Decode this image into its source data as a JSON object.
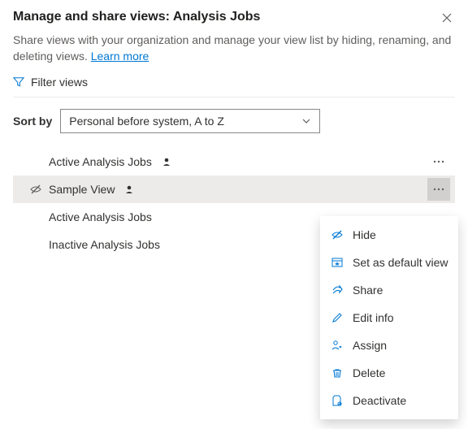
{
  "header": {
    "title": "Manage and share views: Analysis Jobs",
    "subtitle_pre": "Share views with your organization and manage your view list by hiding, renaming, and deleting views. ",
    "learn_more": "Learn more"
  },
  "filter": {
    "label": "Filter views"
  },
  "sort": {
    "label": "Sort by",
    "selected": "Personal before system, A to Z"
  },
  "views": [
    {
      "name": "Active Analysis Jobs",
      "personal": true,
      "hidden": false,
      "selected": false,
      "more": true
    },
    {
      "name": "Sample View",
      "personal": true,
      "hidden": true,
      "selected": true,
      "more": true
    },
    {
      "name": "Active Analysis Jobs",
      "personal": false,
      "hidden": false,
      "selected": false,
      "more": false
    },
    {
      "name": "Inactive Analysis Jobs",
      "personal": false,
      "hidden": false,
      "selected": false,
      "more": false
    }
  ],
  "menu": {
    "items": [
      {
        "icon": "hide",
        "label": "Hide"
      },
      {
        "icon": "default",
        "label": "Set as default view"
      },
      {
        "icon": "share",
        "label": "Share"
      },
      {
        "icon": "edit",
        "label": "Edit info"
      },
      {
        "icon": "assign",
        "label": "Assign"
      },
      {
        "icon": "delete",
        "label": "Delete"
      },
      {
        "icon": "deactivate",
        "label": "Deactivate"
      }
    ]
  }
}
